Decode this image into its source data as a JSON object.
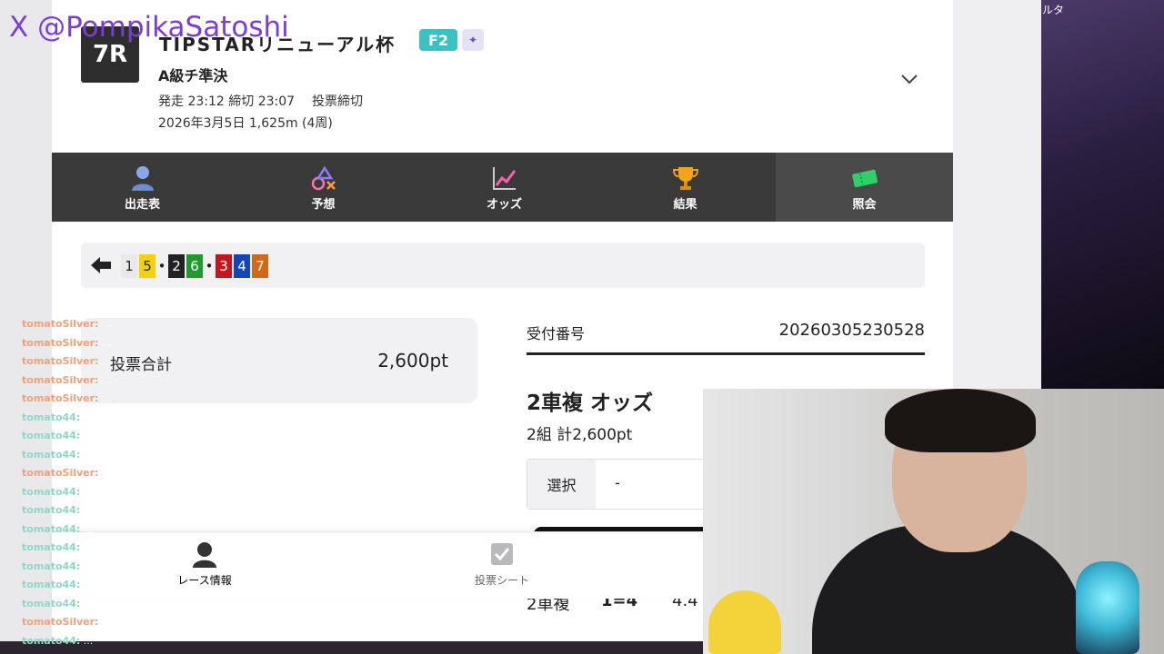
{
  "race": {
    "number": "7R",
    "name": "TIPSTARリニューアル杯",
    "grade": "F2",
    "class": "A級チ準決",
    "start_label": "発走",
    "start_time": "23:12",
    "close_label": "締切",
    "close_time": "23:07",
    "status": "投票締切",
    "date_distance": "2026年3月5日 1,625m (4周)"
  },
  "nav": {
    "items": [
      {
        "label": "出走表",
        "icon": "person-icon"
      },
      {
        "label": "予想",
        "icon": "prediction-icon"
      },
      {
        "label": "オッズ",
        "icon": "chart-icon"
      },
      {
        "label": "結果",
        "icon": "trophy-icon"
      },
      {
        "label": "照会",
        "icon": "ticket-icon",
        "active": true
      }
    ]
  },
  "combo": {
    "cells": [
      {
        "text": "1",
        "bg": "#e9e9e9",
        "fg": "#222"
      },
      {
        "text": "5",
        "bg": "#f5d10a",
        "fg": "#222"
      },
      {
        "text": "•",
        "dot": true
      },
      {
        "text": "2",
        "bg": "#222222",
        "fg": "#fff"
      },
      {
        "text": "6",
        "bg": "#1f9a2c",
        "fg": "#fff"
      },
      {
        "text": "•",
        "dot": true
      },
      {
        "text": "3",
        "bg": "#c4161c",
        "fg": "#fff"
      },
      {
        "text": "4",
        "bg": "#1046b8",
        "fg": "#fff"
      },
      {
        "text": "7",
        "bg": "#d06a18",
        "fg": "#fff"
      }
    ]
  },
  "summary": {
    "total_label": "投票合計",
    "total_value": "2,600pt",
    "receipt_label": "受付番号",
    "receipt_value": "20260305230528",
    "odds_title": "2車複 オッズ",
    "odds_sub": "2組 計2,600pt",
    "select_label": "選択",
    "select_value": "-",
    "row_type": "2車複",
    "row_combo": "1=4",
    "row_odds": "4.4"
  },
  "bottom_tabs": {
    "race_info": "レース情報",
    "ticket_sheet": "投票シート"
  },
  "chat": [
    {
      "user": "tomatoSilver:",
      "msg": "..."
    },
    {
      "user": "tomatoSilver:",
      "msg": "..."
    },
    {
      "user": "tomatoSilver:",
      "msg": "..."
    },
    {
      "user": "tomatoSilver:",
      "msg": "..."
    },
    {
      "user": "tomatoSilver:",
      "msg": "..."
    },
    {
      "user": "tomato44:",
      "msg": "..."
    },
    {
      "user": "tomato44:",
      "msg": "..."
    },
    {
      "user": "tomato44:",
      "msg": "..."
    },
    {
      "user": "tomatoSilver:",
      "msg": "..."
    },
    {
      "user": "tomato44:",
      "msg": "..."
    },
    {
      "user": "tomato44:",
      "msg": "..."
    },
    {
      "user": "tomato44:",
      "msg": "..."
    },
    {
      "user": "tomato44:",
      "msg": "..."
    },
    {
      "user": "tomato44:",
      "msg": "..."
    },
    {
      "user": "tomato44:",
      "msg": "..."
    },
    {
      "user": "tomato44:",
      "msg": "..."
    },
    {
      "user": "tomatoSilver:",
      "msg": "..."
    },
    {
      "user": "tomato44:",
      "msg": "..."
    }
  ],
  "watermark": "X @PompikaSatoshi",
  "colors": {
    "navbar": "#3a3a3a",
    "accent_grade": "#3bc1c1",
    "watermark": "#7a3dd6"
  }
}
